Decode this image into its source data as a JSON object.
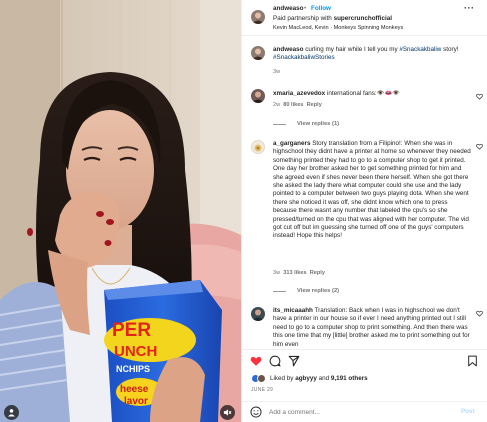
{
  "header": {
    "username": "andweaso",
    "dot": "•",
    "follow_label": "Follow",
    "partnership_prefix": "Paid partnership with ",
    "partner": "supercrunchofficial",
    "audio": "Kevin MacLeod, Kevin · Monkeys Spinning Monkeys",
    "more": "···"
  },
  "caption": {
    "username": "andweaso",
    "text": "curling my hair while I tell you my",
    "tag1": "#Snackakbaliw",
    "text2": " story!",
    "tag2": "#SnackakbaliwStories",
    "time": "3w"
  },
  "comments": [
    {
      "username": "xmaria_azevedox",
      "text": "international fans:👁️👄👁️",
      "time": "2w",
      "likes": "80 likes",
      "reply_label": "Reply",
      "view_replies": "View replies (1)"
    },
    {
      "username": "a_garganers",
      "text": "Story translation from a Filipino!: When she was in highschool they didnt have a printer at home so whenever they needed something printed they had to go to a computer shop to get it printed. One day her brother asked her to get something printed for him and she agreed even if shes never been there herself. When she got there she asked the lady there what computer could she use and the lady pointed to a computer between two guys playing dota. When she went there she noticed it was off, she didnt know which one to press because there wasnt any number that labeled the cpu's so she pressed/turned on the cpu that was aligned with her computer. The vid got cut off but im guessing she turned off one of the guys' computers instead! Hope this helps!",
      "time": "3w",
      "likes": "313 likes",
      "reply_label": "Reply",
      "view_replies": "View replies (2)"
    },
    {
      "username": "its_micaaahh",
      "text": "Translation: Back when I was in highschool we don't have a printer in our house so if ever I need anything printed out I still need to go to a computer shop to print something. And then there was this one time that my [little] brother asked me to print something out for him even"
    }
  ],
  "actions": {
    "liked_by_prefix": "Liked by ",
    "liked_by_user": "agbyyy",
    "liked_by_and": " and ",
    "others": "9,191 others",
    "date": "JUNE 29"
  },
  "add_comment": {
    "placeholder": "Add a comment...",
    "post_label": "Post"
  }
}
